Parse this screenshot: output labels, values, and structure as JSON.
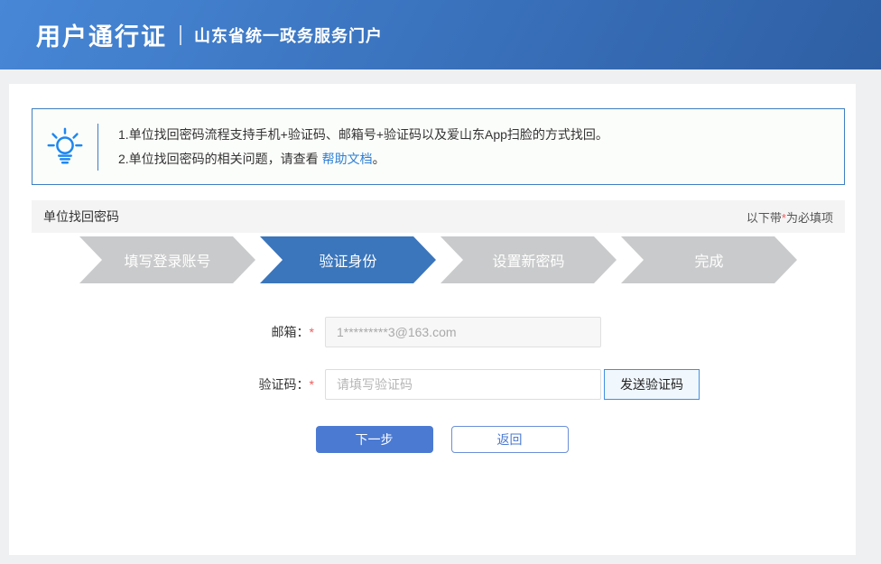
{
  "header": {
    "title": "用户通行证",
    "subtitle": "山东省统一政务服务门户"
  },
  "notice": {
    "line1": "1.单位找回密码流程支持手机+验证码、邮箱号+验证码以及爱山东App扫脸的方式找回。",
    "line2_prefix": "2.单位找回密码的相关问题，请查看 ",
    "line2_link": "帮助文档",
    "line2_suffix": "。"
  },
  "section": {
    "title": "单位找回密码",
    "required_prefix": "以下带",
    "required_star": "*",
    "required_suffix": "为必填项"
  },
  "steps": [
    {
      "label": "填写登录账号",
      "active": false
    },
    {
      "label": "验证身份",
      "active": true
    },
    {
      "label": "设置新密码",
      "active": false
    },
    {
      "label": "完成",
      "active": false
    }
  ],
  "form": {
    "email_label": "邮箱：",
    "email_star": "*",
    "email_value": "1*********3@163.com",
    "code_label": "验证码：",
    "code_star": "*",
    "code_placeholder": "请填写验证码",
    "send_code": "发送验证码",
    "next": "下一步",
    "back": "返回"
  },
  "colors": {
    "header_gradient_start": "#4787d6",
    "header_gradient_end": "#2e5fa4",
    "active_step": "#3b76bc",
    "inactive_step": "#c9cacb",
    "primary_button": "#4b7ad2",
    "notice_border": "#3e7ec2",
    "link_blue": "#2e7fd5",
    "required_red": "#f05b5b",
    "icon_blue": "#1e87f0"
  }
}
